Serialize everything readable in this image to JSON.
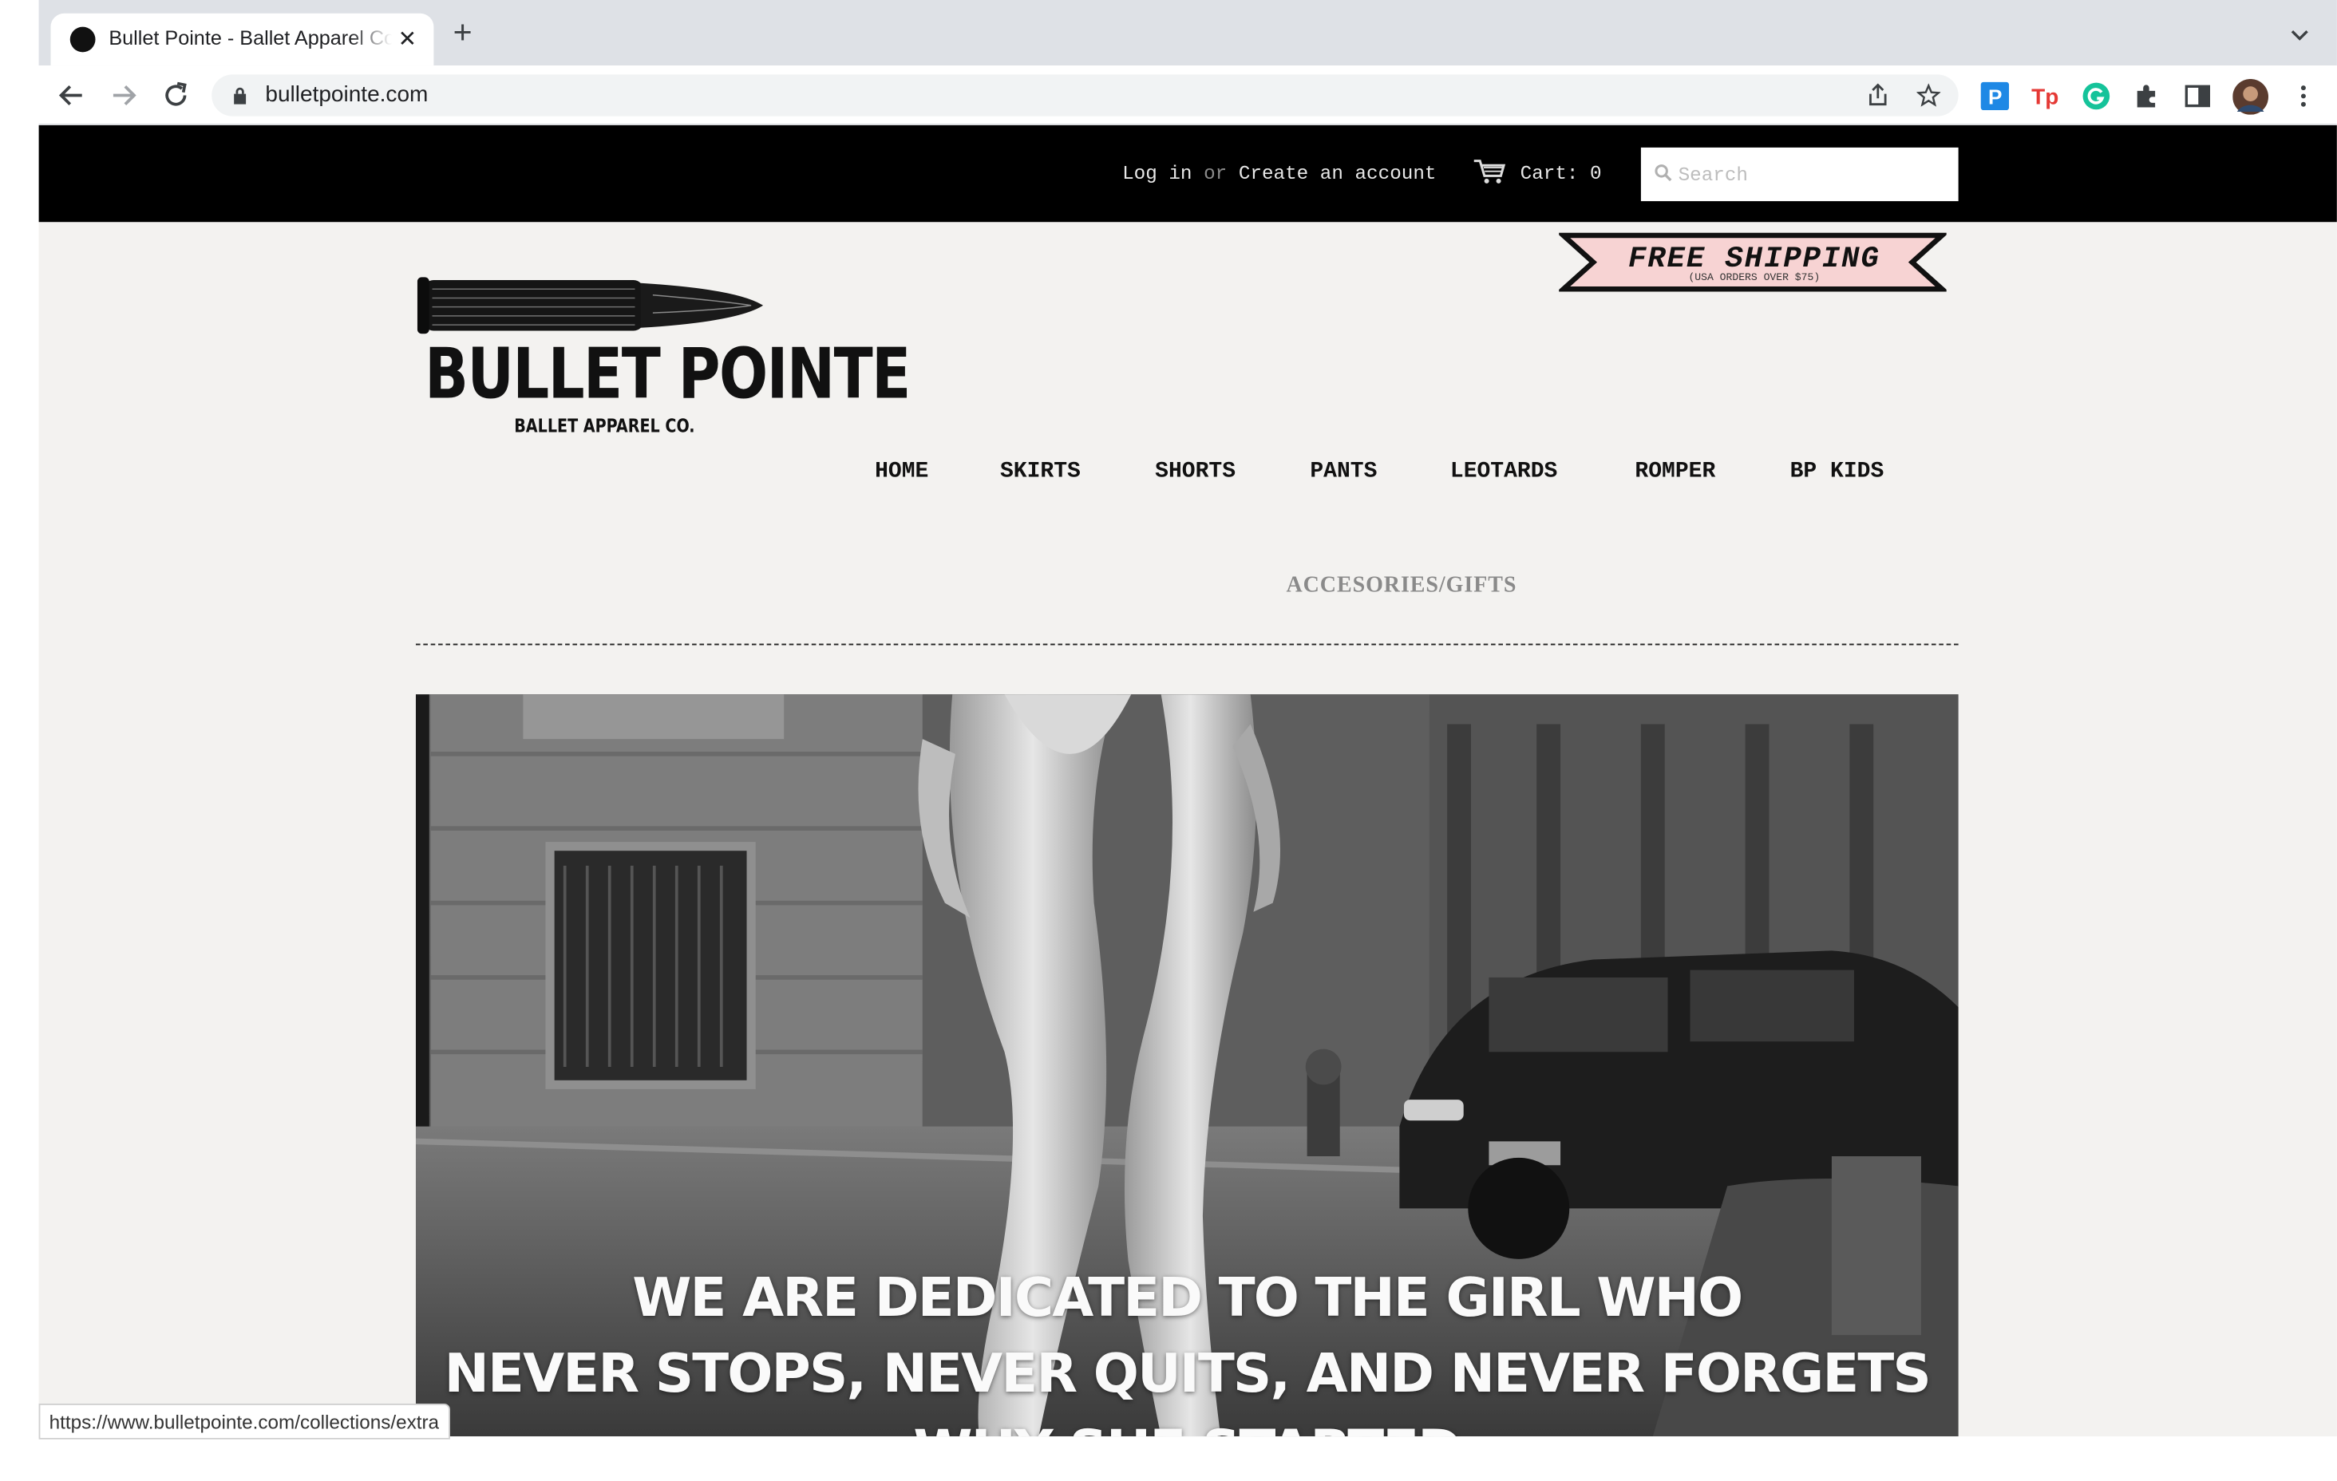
{
  "browser": {
    "tab_title": "Bullet Pointe - Ballet Apparel Co",
    "url": "bulletpointe.com",
    "status_url": "https://www.bulletpointe.com/collections/extra"
  },
  "header": {
    "login_label": "Log in",
    "or_label": "or",
    "create_account_label": "Create an account",
    "cart_label": "Cart: 0",
    "search_placeholder": "Search"
  },
  "banner": {
    "title": "FREE SHIPPING",
    "subtitle": "(USA ORDERS OVER $75)"
  },
  "logo": {
    "name": "BULLET POINTE",
    "tagline": "BALLET APPAREL CO."
  },
  "nav": {
    "items": [
      "HOME",
      "SKIRTS",
      "SHORTS",
      "PANTS",
      "LEOTARDS",
      "ROMPER",
      "BP KIDS"
    ],
    "second_row": "ACCESORIES/GIFTS"
  },
  "hero": {
    "line1": "WE ARE DEDICATED TO THE GIRL WHO",
    "line2": "NEVER STOPS, NEVER QUITS, AND NEVER FORGETS",
    "line3": "WHY SHE STARTED"
  },
  "colors": {
    "topbar": "#000000",
    "page_background": "#f3f2f0",
    "banner_fill": "#f7d3d3",
    "nav_secondary": "#8a8a8a"
  }
}
